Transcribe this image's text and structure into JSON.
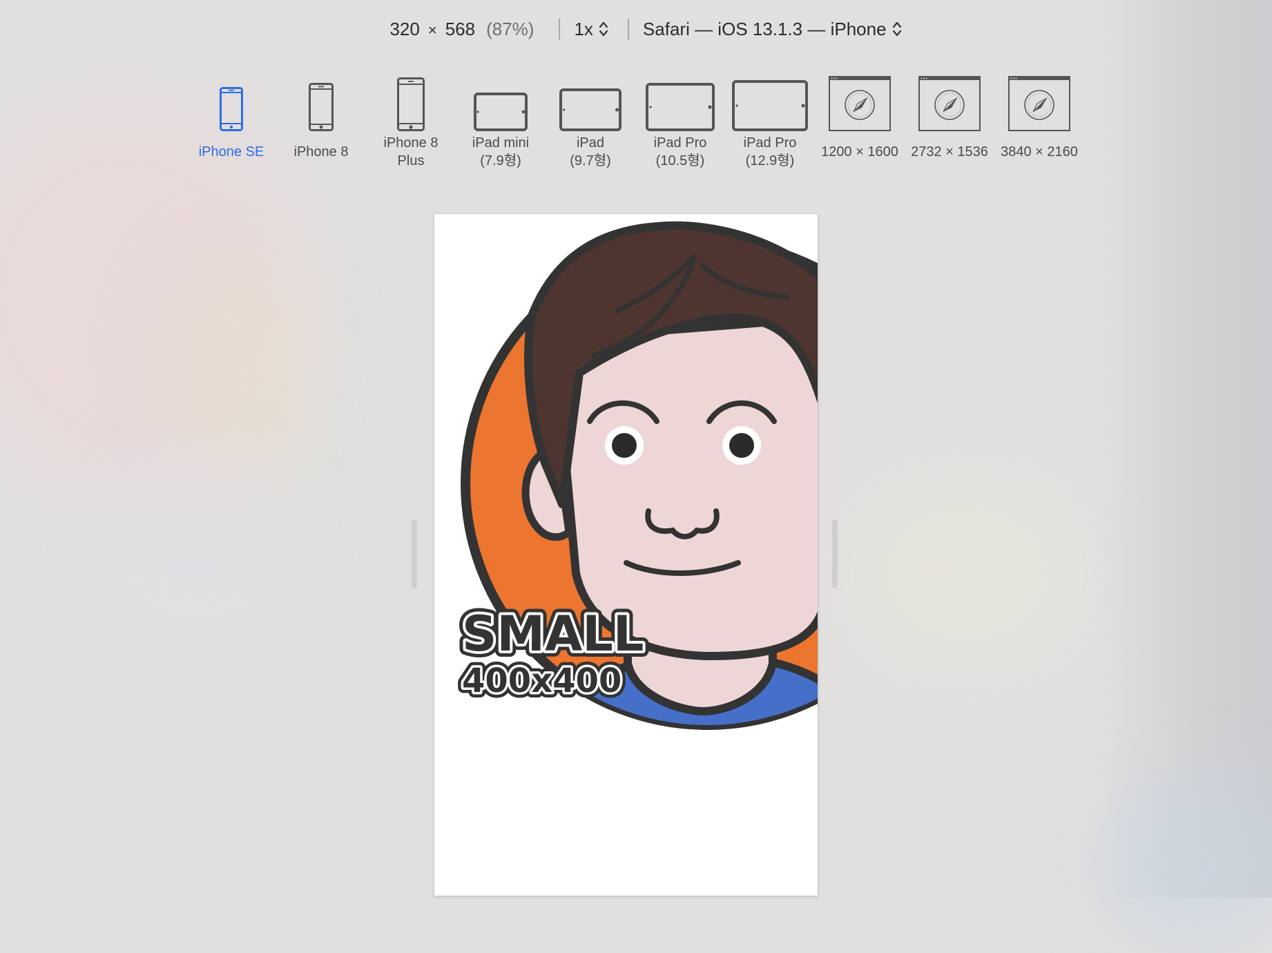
{
  "toolbar": {
    "width": "320",
    "times": "×",
    "height": "568",
    "zoom": "(87%)",
    "scale": "1x",
    "user_agent": "Safari — iOS 13.1.3 — iPhone"
  },
  "devices": [
    {
      "label": "iPhone SE",
      "icon": "phone-icon",
      "active": true
    },
    {
      "label": "iPhone 8",
      "icon": "phone-icon"
    },
    {
      "label_line1": "iPhone 8",
      "label_line2": "Plus",
      "icon": "phone-icon"
    },
    {
      "label_line1": "iPad mini",
      "label_line2": "(7.9형)",
      "icon": "tablet-icon"
    },
    {
      "label_line1": "iPad",
      "label_line2": "(9.7형)",
      "icon": "tablet-icon"
    },
    {
      "label_line1": "iPad Pro",
      "label_line2": "(10.5형)",
      "icon": "tablet-icon"
    },
    {
      "label_line1": "iPad Pro",
      "label_line2": "(12.9형)",
      "icon": "tablet-icon"
    },
    {
      "label": "1200 × 1600",
      "icon": "browser-window-icon"
    },
    {
      "label": "2732 × 1536",
      "icon": "browser-window-icon"
    },
    {
      "label": "3840 × 2160",
      "icon": "browser-window-icon"
    }
  ],
  "content": {
    "badge_line1": "SMALL",
    "badge_line2": "400x400"
  },
  "colors": {
    "accent": "#2a6ee6",
    "avatar_orange": "#ec7530",
    "avatar_blue": "#456fc8",
    "hair": "#4e3530",
    "skin": "#efd6d6",
    "outline": "#333333"
  }
}
